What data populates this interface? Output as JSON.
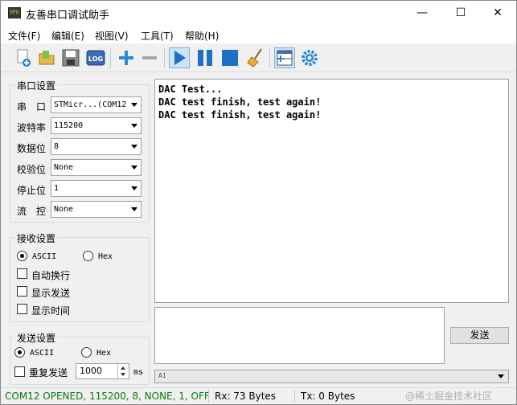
{
  "window": {
    "title": "友善串口调试助手",
    "app_icon_text": "SPU",
    "minimize_glyph": "—",
    "maximize_glyph": "☐",
    "close_glyph": "✕"
  },
  "menu": {
    "items": [
      {
        "label": "文件(F)"
      },
      {
        "label": "编辑(E)"
      },
      {
        "label": "视图(V)"
      },
      {
        "label": "工具(T)"
      },
      {
        "label": "帮助(H)"
      }
    ]
  },
  "toolbar": {
    "log_label": "LOG",
    "icons": [
      "new-session-icon",
      "open-folder-icon",
      "save-icon",
      "log-icon",
      "add-icon",
      "remove-icon",
      "play-icon",
      "pause-icon",
      "stop-icon",
      "clear-broom-icon",
      "layout-icon",
      "settings-gear-icon"
    ]
  },
  "serial_settings": {
    "title": "串口设置",
    "rows": [
      {
        "label": "串　口",
        "value": "STMicr...(COM12"
      },
      {
        "label": "波特率",
        "value": "115200"
      },
      {
        "label": "数据位",
        "value": "8"
      },
      {
        "label": "校验位",
        "value": "None"
      },
      {
        "label": "停止位",
        "value": "1"
      },
      {
        "label": "流　控",
        "value": "None"
      }
    ]
  },
  "receive_settings": {
    "title": "接收设置",
    "ascii_label": "ASCII",
    "hex_label": "Hex",
    "selected_mode": "ASCII",
    "auto_wrap_label": "自动换行",
    "show_send_label": "显示发送",
    "show_time_label": "显示时间"
  },
  "send_settings": {
    "title": "发送设置",
    "ascii_label": "ASCII",
    "hex_label": "Hex",
    "selected_mode": "ASCII",
    "repeat_label": "重复发送",
    "repeat_interval": "1000",
    "unit": "ms"
  },
  "receive_area": {
    "lines": [
      "DAC Test...",
      "DAC test finish, test again!",
      "DAC test finish, test again!"
    ]
  },
  "send_area": {
    "button_label": "发送",
    "history_value": "A1"
  },
  "status": {
    "connection": "COM12 OPENED, 115200, 8, NONE, 1, OFF",
    "rx": "Rx: 73 Bytes",
    "tx": "Tx: 0 Bytes",
    "watermark": "@稀土掘金技术社区"
  },
  "colors": {
    "accent_blue": "#1e6fc8",
    "status_green": "#0a7a0a",
    "toolbar_active": "#cfe3f7"
  }
}
